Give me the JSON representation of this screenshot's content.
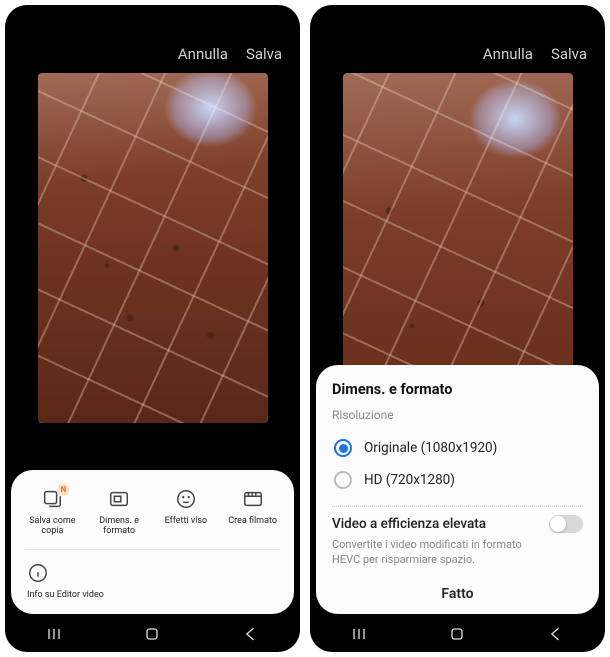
{
  "left": {
    "topbar": {
      "cancel": "Annulla",
      "save": "Salva"
    },
    "tools": {
      "save_copy": "Salva come copia",
      "size_format": "Dimens. e formato",
      "face_effects": "Effetti viso",
      "create_movie": "Crea filmato",
      "badge": "N"
    },
    "info": "Info su Editor video"
  },
  "right": {
    "topbar": {
      "cancel": "Annulla",
      "save": "Salva"
    },
    "sheet": {
      "title": "Dimens. e formato",
      "subtitle": "Risoluzione",
      "options": [
        {
          "label": "Originale  (1080x1920)",
          "selected": true
        },
        {
          "label": "HD  (720x1280)",
          "selected": false
        }
      ],
      "efficiency_title": "Video a efficienza elevata",
      "efficiency_desc": "Convertite i video modificati in formato HEVC per risparmiare spazio.",
      "done": "Fatto"
    }
  }
}
